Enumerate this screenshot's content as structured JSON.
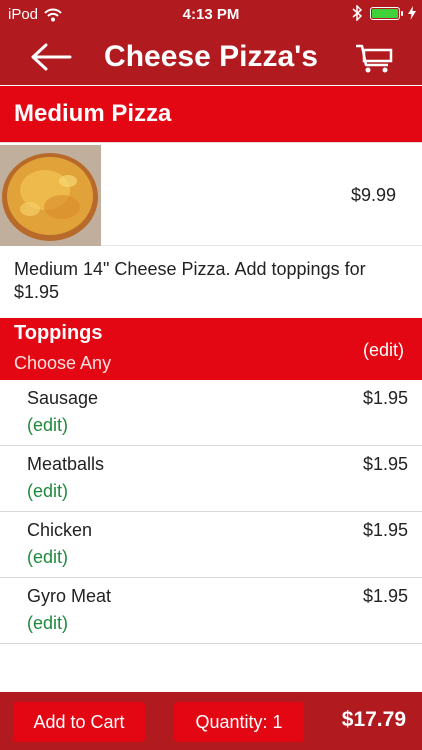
{
  "status_bar": {
    "carrier": "iPod",
    "time": "4:13 PM",
    "battery_level": 1.0
  },
  "nav": {
    "title": "Cheese Pizza's",
    "back_icon": "back-arrow-icon",
    "cart_icon": "cart-icon"
  },
  "size_section": {
    "title": "Medium Pizza"
  },
  "product": {
    "price": "$9.99",
    "description": "Medium 14\" Cheese Pizza. Add toppings for $1.95"
  },
  "toppings": {
    "title": "Toppings",
    "subtitle": "Choose Any",
    "edit_label": "(edit)",
    "items": [
      {
        "name": "Sausage",
        "price": "$1.95",
        "edit": "(edit)"
      },
      {
        "name": "Meatballs",
        "price": "$1.95",
        "edit": "(edit)"
      },
      {
        "name": "Chicken",
        "price": "$1.95",
        "edit": "(edit)"
      },
      {
        "name": "Gyro Meat",
        "price": "$1.95",
        "edit": "(edit)"
      }
    ]
  },
  "bottom_bar": {
    "add_to_cart": "Add to Cart",
    "quantity": "Quantity: 1",
    "total": "$17.79"
  },
  "colors": {
    "header_dark": "#b11a1e",
    "header_bright": "#e30613",
    "edit_green": "#1f8a3c"
  }
}
